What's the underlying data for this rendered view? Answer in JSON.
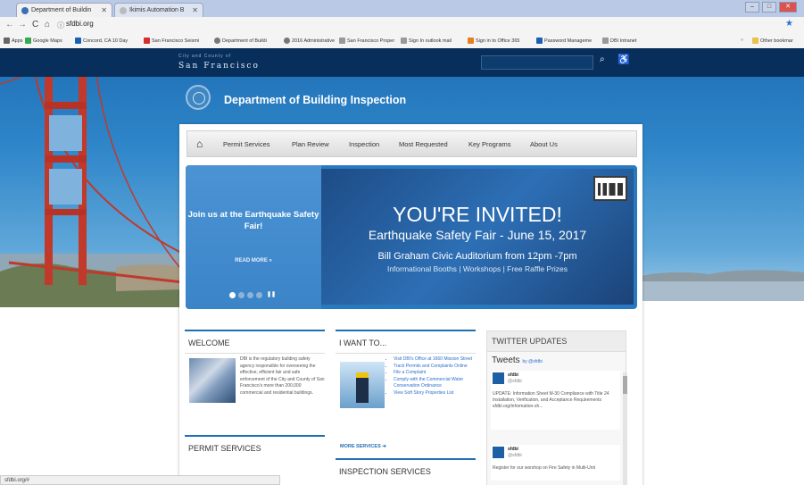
{
  "browser": {
    "tabs": [
      {
        "title": "Department of Buildin",
        "favicon_color": "#3b6fb6"
      },
      {
        "title": "Ikimis Automation B",
        "favicon_color": "#bbbbbb"
      }
    ],
    "url": "sfdbi.org",
    "bookmarks": [
      {
        "label": "Apps",
        "color": "#666666"
      },
      {
        "label": "Google Maps",
        "color": "#34a853"
      },
      {
        "label": "Concord, CA 10 Day",
        "color": "#1a5fb4"
      },
      {
        "label": "San Francisco Seismi",
        "color": "#d32f2f"
      },
      {
        "label": "Department of Buildi",
        "color": "#777777"
      },
      {
        "label": "2016 Administrative",
        "color": "#777777"
      },
      {
        "label": "San Francisco Proper",
        "color": "#999999"
      },
      {
        "label": "Sign In outlook mail",
        "color": "#999999"
      },
      {
        "label": "Sign in to Office 365",
        "color": "#e67e22"
      },
      {
        "label": "Password Manageme",
        "color": "#1a5fb4"
      },
      {
        "label": "DBI Intranet",
        "color": "#999999"
      },
      {
        "label": "Other bookmar",
        "color": "#e8c14e"
      }
    ],
    "status_text": "sfdbi.org/#"
  },
  "header": {
    "city_small": "City and County of",
    "city_big": "San Francisco",
    "department": "Department of Building Inspection"
  },
  "menu": {
    "items": [
      "Permit Services",
      "Plan Review",
      "Inspection",
      "Most Requested",
      "Key Programs",
      "About Us"
    ]
  },
  "banner": {
    "join": "Join us at the Earthquake Safety Fair!",
    "read_more": "READ MORE »",
    "invited": "YOU'RE INVITED!",
    "fair_date": "Earthquake Safety Fair - June 15, 2017",
    "auditorium": "Bill Graham Civic Auditorium from 12pm -7pm",
    "booths": "Informational Booths | Workshops | Free Raffle Prizes"
  },
  "welcome": {
    "heading": "WELCOME",
    "text": "DBI is the regulatory building safety agency responsible for overseeing the effective, efficient fair and safe enforcement of the City and County of San Francisco's more than 200,000 commercial and residential buildings."
  },
  "permit_services": {
    "heading": "PERMIT SERVICES"
  },
  "i_want_to": {
    "heading": "I WANT TO...",
    "links": [
      "Visit DBI's Office at 1660 Mission Street",
      "Track Permits and Complaints Online",
      "File a Complaint",
      "Comply with the Commercial Water Conservation Ordinance",
      "View Soft Story Properties List"
    ],
    "more": "MORE SERVICES"
  },
  "inspection_services": {
    "heading": "INSPECTION SERVICES"
  },
  "twitter": {
    "heading": "TWITTER UPDATES",
    "tweets_label": "Tweets",
    "by": "by @sfdbi",
    "tweet1": {
      "name": "sfdbi",
      "handle": "@sfdbi",
      "text": "UPDATE: Information Sheet M-30 Compliance with Title 24 Installation, Verification, and Acceptance Requirements sfdbi.org/information-sh..."
    },
    "tweet2": {
      "name": "sfdbi",
      "handle": "@sfdbi",
      "text": "Register for our worshop on Fire Safety in Multi-Unit"
    }
  }
}
